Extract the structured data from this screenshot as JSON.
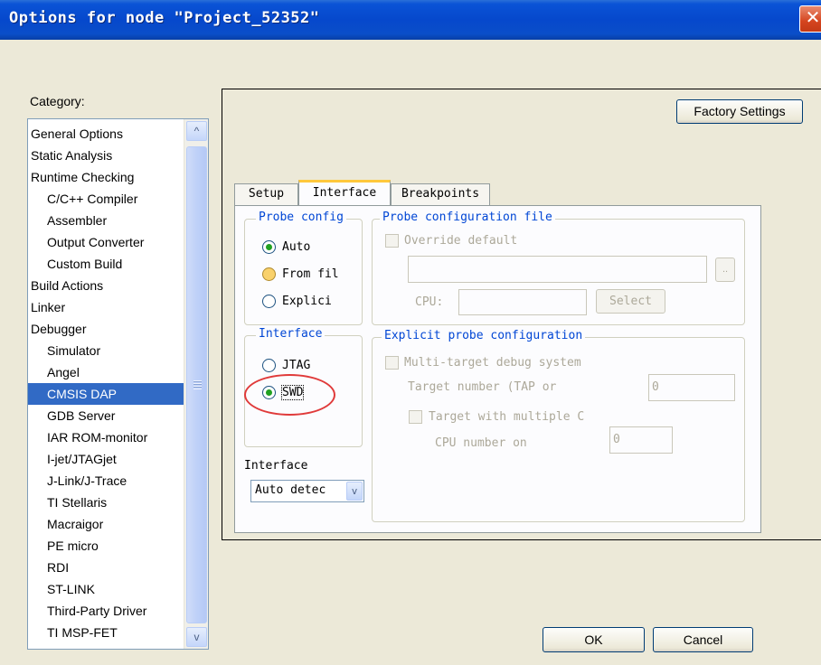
{
  "window": {
    "title": "Options for node \"Project_52352\"",
    "close_glyph": "✕"
  },
  "category": {
    "label": "Category:",
    "items": [
      {
        "label": "General Options",
        "indent": 0
      },
      {
        "label": "Static Analysis",
        "indent": 0
      },
      {
        "label": "Runtime Checking",
        "indent": 0
      },
      {
        "label": "C/C++ Compiler",
        "indent": 1
      },
      {
        "label": "Assembler",
        "indent": 1
      },
      {
        "label": "Output Converter",
        "indent": 1
      },
      {
        "label": "Custom Build",
        "indent": 1
      },
      {
        "label": "Build Actions",
        "indent": 0
      },
      {
        "label": "Linker",
        "indent": 0
      },
      {
        "label": "Debugger",
        "indent": 0
      },
      {
        "label": "Simulator",
        "indent": 1
      },
      {
        "label": "Angel",
        "indent": 1
      },
      {
        "label": "CMSIS DAP",
        "indent": 1,
        "selected": true
      },
      {
        "label": "GDB Server",
        "indent": 1
      },
      {
        "label": "IAR ROM-monitor",
        "indent": 1
      },
      {
        "label": "I-jet/JTAGjet",
        "indent": 1
      },
      {
        "label": "J-Link/J-Trace",
        "indent": 1
      },
      {
        "label": "TI Stellaris",
        "indent": 1
      },
      {
        "label": "Macraigor",
        "indent": 1
      },
      {
        "label": "PE micro",
        "indent": 1
      },
      {
        "label": "RDI",
        "indent": 1
      },
      {
        "label": "ST-LINK",
        "indent": 1
      },
      {
        "label": "Third-Party Driver",
        "indent": 1
      },
      {
        "label": "TI MSP-FET",
        "indent": 1
      }
    ],
    "scroll_up_icon": "^",
    "scroll_down_icon": "v"
  },
  "buttons": {
    "factory_settings": "Factory Settings",
    "ok": "OK",
    "cancel": "Cancel"
  },
  "tabs": [
    "Setup",
    "Interface",
    "Breakpoints"
  ],
  "active_tab": "Interface",
  "probe_config": {
    "title": "Probe config",
    "options": [
      "Auto",
      "From fil",
      "Explici"
    ],
    "selected": "Auto"
  },
  "probe_file": {
    "title": "Probe configuration file",
    "override_label": "Override default",
    "browse_label": "..",
    "cpu_label": "CPU:",
    "select_label": "Select"
  },
  "interface_group": {
    "title": "Interface",
    "options": [
      "JTAG",
      "SWD"
    ],
    "selected": "SWD"
  },
  "explicit": {
    "title": "Explicit probe configuration",
    "multi_target_label": "Multi-target debug system",
    "target_number_label": "Target number (TAP or",
    "target_number_value": "0",
    "target_multiple_label": "Target with multiple C",
    "cpu_number_label": "CPU number on",
    "cpu_number_value": "0"
  },
  "interface_speed": {
    "label": "Interface",
    "value": "Auto detec",
    "arrow_icon": "v"
  }
}
